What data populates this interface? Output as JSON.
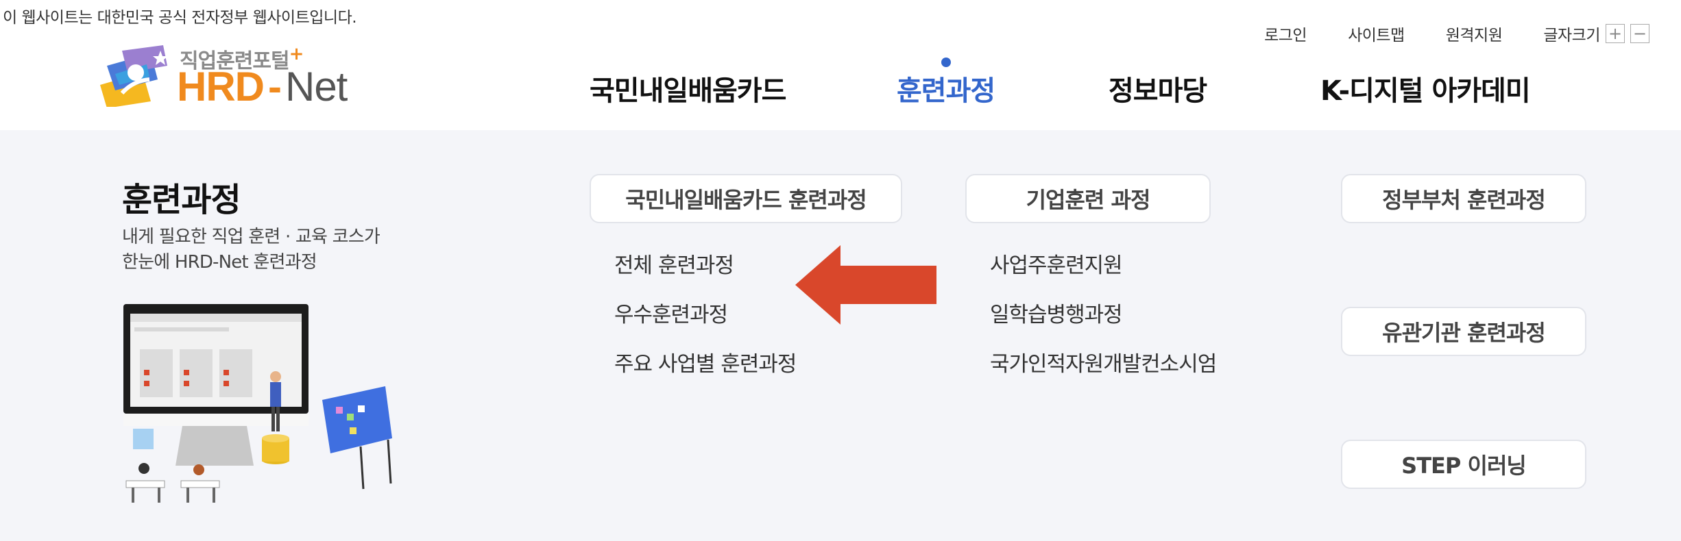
{
  "notice": "이 웹사이트는 대한민국 공식 전자정부 웹사이트입니다.",
  "util_nav": {
    "login": "로그인",
    "sitemap": "사이트맵",
    "remote": "원격지원",
    "font_size": "글자크기",
    "font_plus": "+",
    "font_minus": "−"
  },
  "logo": {
    "sub": "직업훈련포털",
    "plus": "+",
    "hrd": "HRD",
    "dash": "-",
    "net": "Net"
  },
  "gnb": {
    "items": [
      {
        "label": "국민내일배움카드"
      },
      {
        "label": "훈련과정"
      },
      {
        "label": "정보마당"
      },
      {
        "label": "K-디지털 아카데미"
      }
    ],
    "active_color": "#3366cc"
  },
  "panel": {
    "title": "훈련과정",
    "desc_line1": "내게 필요한 직업 훈련 · 교육 코스가",
    "desc_line2": "한눈에 HRD-Net 훈련과정",
    "categories": {
      "national": "국민내일배움카드 훈련과정",
      "enterprise": "기업훈련 과정",
      "ministry": "정부부처 훈련과정",
      "related": "유관기관 훈련과정",
      "step": "STEP 이러닝"
    },
    "national_links": [
      "전체 훈련과정",
      "우수훈련과정",
      "주요 사업별 훈련과정"
    ],
    "enterprise_links": [
      "사업주훈련지원",
      "일학습병행과정",
      "국가인적자원개발컨소시엄"
    ]
  },
  "colors": {
    "accent": "#3366cc",
    "brand_orange": "#f08a1e",
    "panel_bg": "#f4f5f9",
    "arrow": "#d9472b"
  }
}
